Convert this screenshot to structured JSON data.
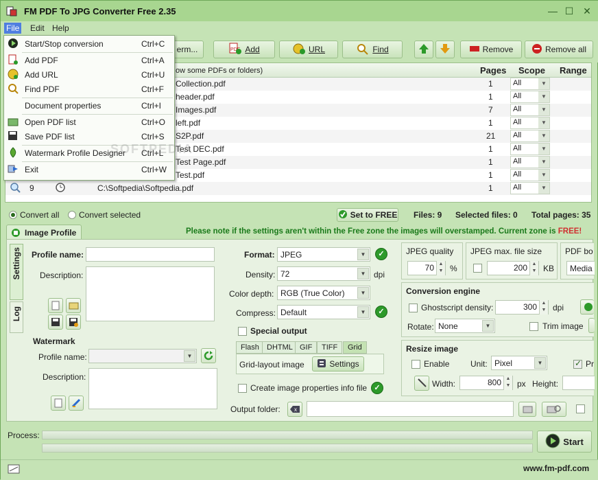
{
  "app": {
    "title": "FM PDF To JPG Converter Free 2.35"
  },
  "menubar": {
    "file": "File",
    "edit": "Edit",
    "help": "Help"
  },
  "file_menu": [
    {
      "label": "Start/Stop conversion",
      "shortcut": "Ctrl+C",
      "icon": "play-icon"
    },
    {
      "label": "Add PDF",
      "shortcut": "Ctrl+A",
      "icon": "add-pdf-icon"
    },
    {
      "label": "Add URL",
      "shortcut": "Ctrl+U",
      "icon": "add-url-icon"
    },
    {
      "label": "Find PDF",
      "shortcut": "Ctrl+F",
      "icon": "find-icon"
    },
    {
      "label": "Document properties",
      "shortcut": "Ctrl+I",
      "icon": ""
    },
    {
      "label": "Open PDF list",
      "shortcut": "Ctrl+O",
      "icon": "open-folder-icon"
    },
    {
      "label": "Save PDF list",
      "shortcut": "Ctrl+S",
      "icon": "save-icon"
    },
    {
      "label": "Watermark Profile Designer",
      "shortcut": "Ctrl+L",
      "icon": "watermark-icon"
    },
    {
      "label": "Exit",
      "shortcut": "Ctrl+W",
      "icon": "exit-icon"
    }
  ],
  "toolbar": {
    "term_partial": "erm...",
    "add": "Add",
    "url": "URL",
    "find": "Find",
    "remove": "Remove",
    "remove_all": "Remove all"
  },
  "list": {
    "hint_partial": "ow some PDFs or folders)",
    "columns": {
      "pages": "Pages",
      "scope": "Scope",
      "range": "Range"
    },
    "rows": [
      {
        "name": "Collection.pdf",
        "pages": "1",
        "scope": "All"
      },
      {
        "name": "header.pdf",
        "pages": "1",
        "scope": "All"
      },
      {
        "name": "Images.pdf",
        "pages": "7",
        "scope": "All"
      },
      {
        "name": "left.pdf",
        "pages": "1",
        "scope": "All"
      },
      {
        "name": "S2P.pdf",
        "pages": "21",
        "scope": "All"
      },
      {
        "name": "Test DEC.pdf",
        "pages": "1",
        "scope": "All"
      },
      {
        "name": "Test Page.pdf",
        "pages": "1",
        "scope": "All"
      },
      {
        "name": "Test.pdf",
        "pages": "1",
        "scope": "All"
      },
      {
        "num": "9",
        "name": "C:\\Softpedia\\Softpedia.pdf",
        "pages": "1",
        "scope": "All"
      }
    ]
  },
  "status": {
    "convert_all": "Convert all",
    "convert_selected": "Convert selected",
    "set_to_free": "Set to FREE",
    "files": "Files: 9",
    "selected_files": "Selected files: 0",
    "total_pages": "Total pages: 35"
  },
  "profile_tab": "Image Profile",
  "notice": "Please note if the settings aren't within the Free zone the images will overstamped. Current zone is",
  "notice_zone": "FREE!",
  "side_tabs": {
    "settings": "Settings",
    "log": "Log"
  },
  "profile": {
    "name_label": "Profile name:",
    "description_label": "Description:",
    "watermark": "Watermark",
    "wm_profile_name": "Profile name:",
    "wm_description": "Description:"
  },
  "format": {
    "format_label": "Format:",
    "format_value": "JPEG",
    "density_label": "Density:",
    "density_value": "72",
    "density_unit": "dpi",
    "color_label": "Color depth:",
    "color_value": "RGB (True Color)",
    "compress_label": "Compress:",
    "compress_value": "Default",
    "special_output": "Special output",
    "tabs": [
      "Flash",
      "DHTML",
      "GIF",
      "TIFF",
      "Grid"
    ],
    "grid_layout": "Grid-layout image",
    "settings_btn": "Settings",
    "info_file": "Create image properties info file",
    "output_folder": "Output folder:"
  },
  "jpeg": {
    "quality_label": "JPEG quality",
    "quality_value": "70",
    "quality_unit": "%",
    "max_size_label": "JPEG max. file size",
    "max_size_value": "200",
    "max_size_unit": "KB",
    "pdf_box_label": "PDF bo",
    "pdf_box_value": "Media"
  },
  "engine": {
    "title": "Conversion engine",
    "gs_density": "Ghostscript density:",
    "gs_value": "300",
    "gs_unit": "dpi",
    "rotate_label": "Rotate:",
    "rotate_value": "None",
    "trim": "Trim image"
  },
  "resize": {
    "title": "Resize image",
    "enable": "Enable",
    "unit_label": "Unit:",
    "unit_value": "Pixel",
    "pr_partial": "Pr",
    "width_label": "Width:",
    "width_value": "800",
    "width_unit": "px",
    "height_label": "Height:"
  },
  "bottom": {
    "process": "Process:",
    "start": "Start",
    "website": "www.fm-pdf.com"
  },
  "watermark_text": "SOFTPEDIA"
}
